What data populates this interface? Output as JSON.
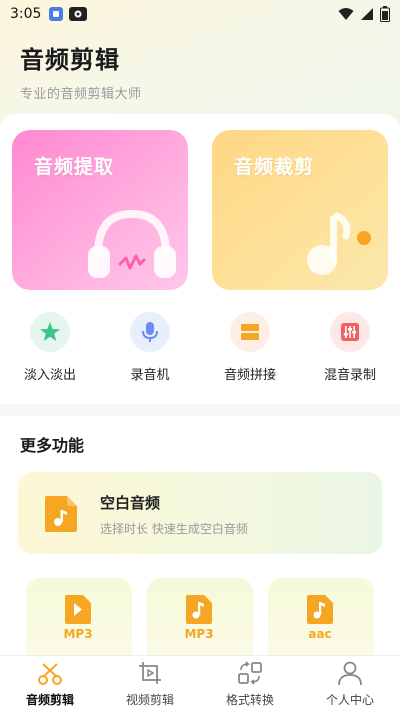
{
  "status_bar": {
    "time": "3:05"
  },
  "header": {
    "title": "音频剪辑",
    "subtitle": "专业的音频剪辑大师"
  },
  "feature_cards": [
    {
      "label": "音频提取"
    },
    {
      "label": "音频裁剪"
    }
  ],
  "tools": [
    {
      "label": "淡入淡出",
      "icon": "star-icon",
      "color": "#3cc48a"
    },
    {
      "label": "录音机",
      "icon": "microphone-icon",
      "color": "#6b8cf0"
    },
    {
      "label": "音频拼接",
      "icon": "splice-icon",
      "color": "#f5a623"
    },
    {
      "label": "混音录制",
      "icon": "mixer-icon",
      "color": "#f06060"
    }
  ],
  "more_section": {
    "title": "更多功能",
    "blank_audio": {
      "title": "空白音频",
      "subtitle": "选择时长 快速生成空白音频"
    },
    "format_cards": [
      {
        "format": "MP3"
      },
      {
        "format": "MP3"
      },
      {
        "format": "aac"
      }
    ]
  },
  "bottom_nav": [
    {
      "label": "音频剪辑",
      "icon": "scissors-icon",
      "active": true
    },
    {
      "label": "视频剪辑",
      "icon": "video-crop-icon",
      "active": false
    },
    {
      "label": "格式转换",
      "icon": "convert-icon",
      "active": false
    },
    {
      "label": "个人中心",
      "icon": "person-icon",
      "active": false
    }
  ],
  "colors": {
    "accent": "#f5a623",
    "pink": "#ff88d0",
    "yellow": "#ffd685"
  }
}
